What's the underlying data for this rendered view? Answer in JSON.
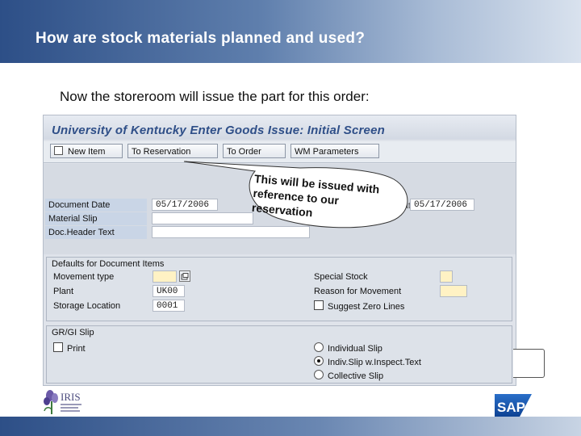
{
  "slide": {
    "title": "How are stock materials planned and used?",
    "subtitle": "Now the storeroom will issue the part for this order:"
  },
  "window": {
    "title": "University of Kentucky Enter Goods Issue: Initial Screen"
  },
  "toolbar": {
    "new_item": "New Item",
    "to_reservation": "To Reservation",
    "to_order": "To Order",
    "wm_parameters": "WM Parameters"
  },
  "header_fields": {
    "document_date_label": "Document Date",
    "document_date_value": "05/17/2006",
    "material_slip_label": "Material Slip",
    "material_slip_value": "",
    "doc_header_text_label": "Doc.Header Text",
    "doc_header_text_value": "",
    "posting_date_label": "Posting Date",
    "posting_date_value": "05/17/2006"
  },
  "defaults": {
    "group_title": "Defaults for Document Items",
    "movement_type_label": "Movement type",
    "movement_type_value": "",
    "plant_label": "Plant",
    "plant_value": "UK00",
    "storage_location_label": "Storage Location",
    "storage_location_value": "0001",
    "special_stock_label": "Special Stock",
    "special_stock_value": "",
    "reason_label": "Reason for Movement",
    "reason_value": "",
    "suggest_zero_lines": "Suggest Zero Lines"
  },
  "slip": {
    "group_title": "GR/GI Slip",
    "print_label": "Print",
    "options": [
      "Individual Slip",
      "Indiv.Slip w.Inspect.Text",
      "Collective Slip"
    ],
    "selected_index": 1
  },
  "callout": {
    "text": "This will be issued with reference to our reservation"
  },
  "logos": {
    "iris": "IRIS",
    "sap": "SAP"
  },
  "colors": {
    "banner": "#2d4f87",
    "window_title": "#2f4f88",
    "required_field": "#fff2c4"
  }
}
